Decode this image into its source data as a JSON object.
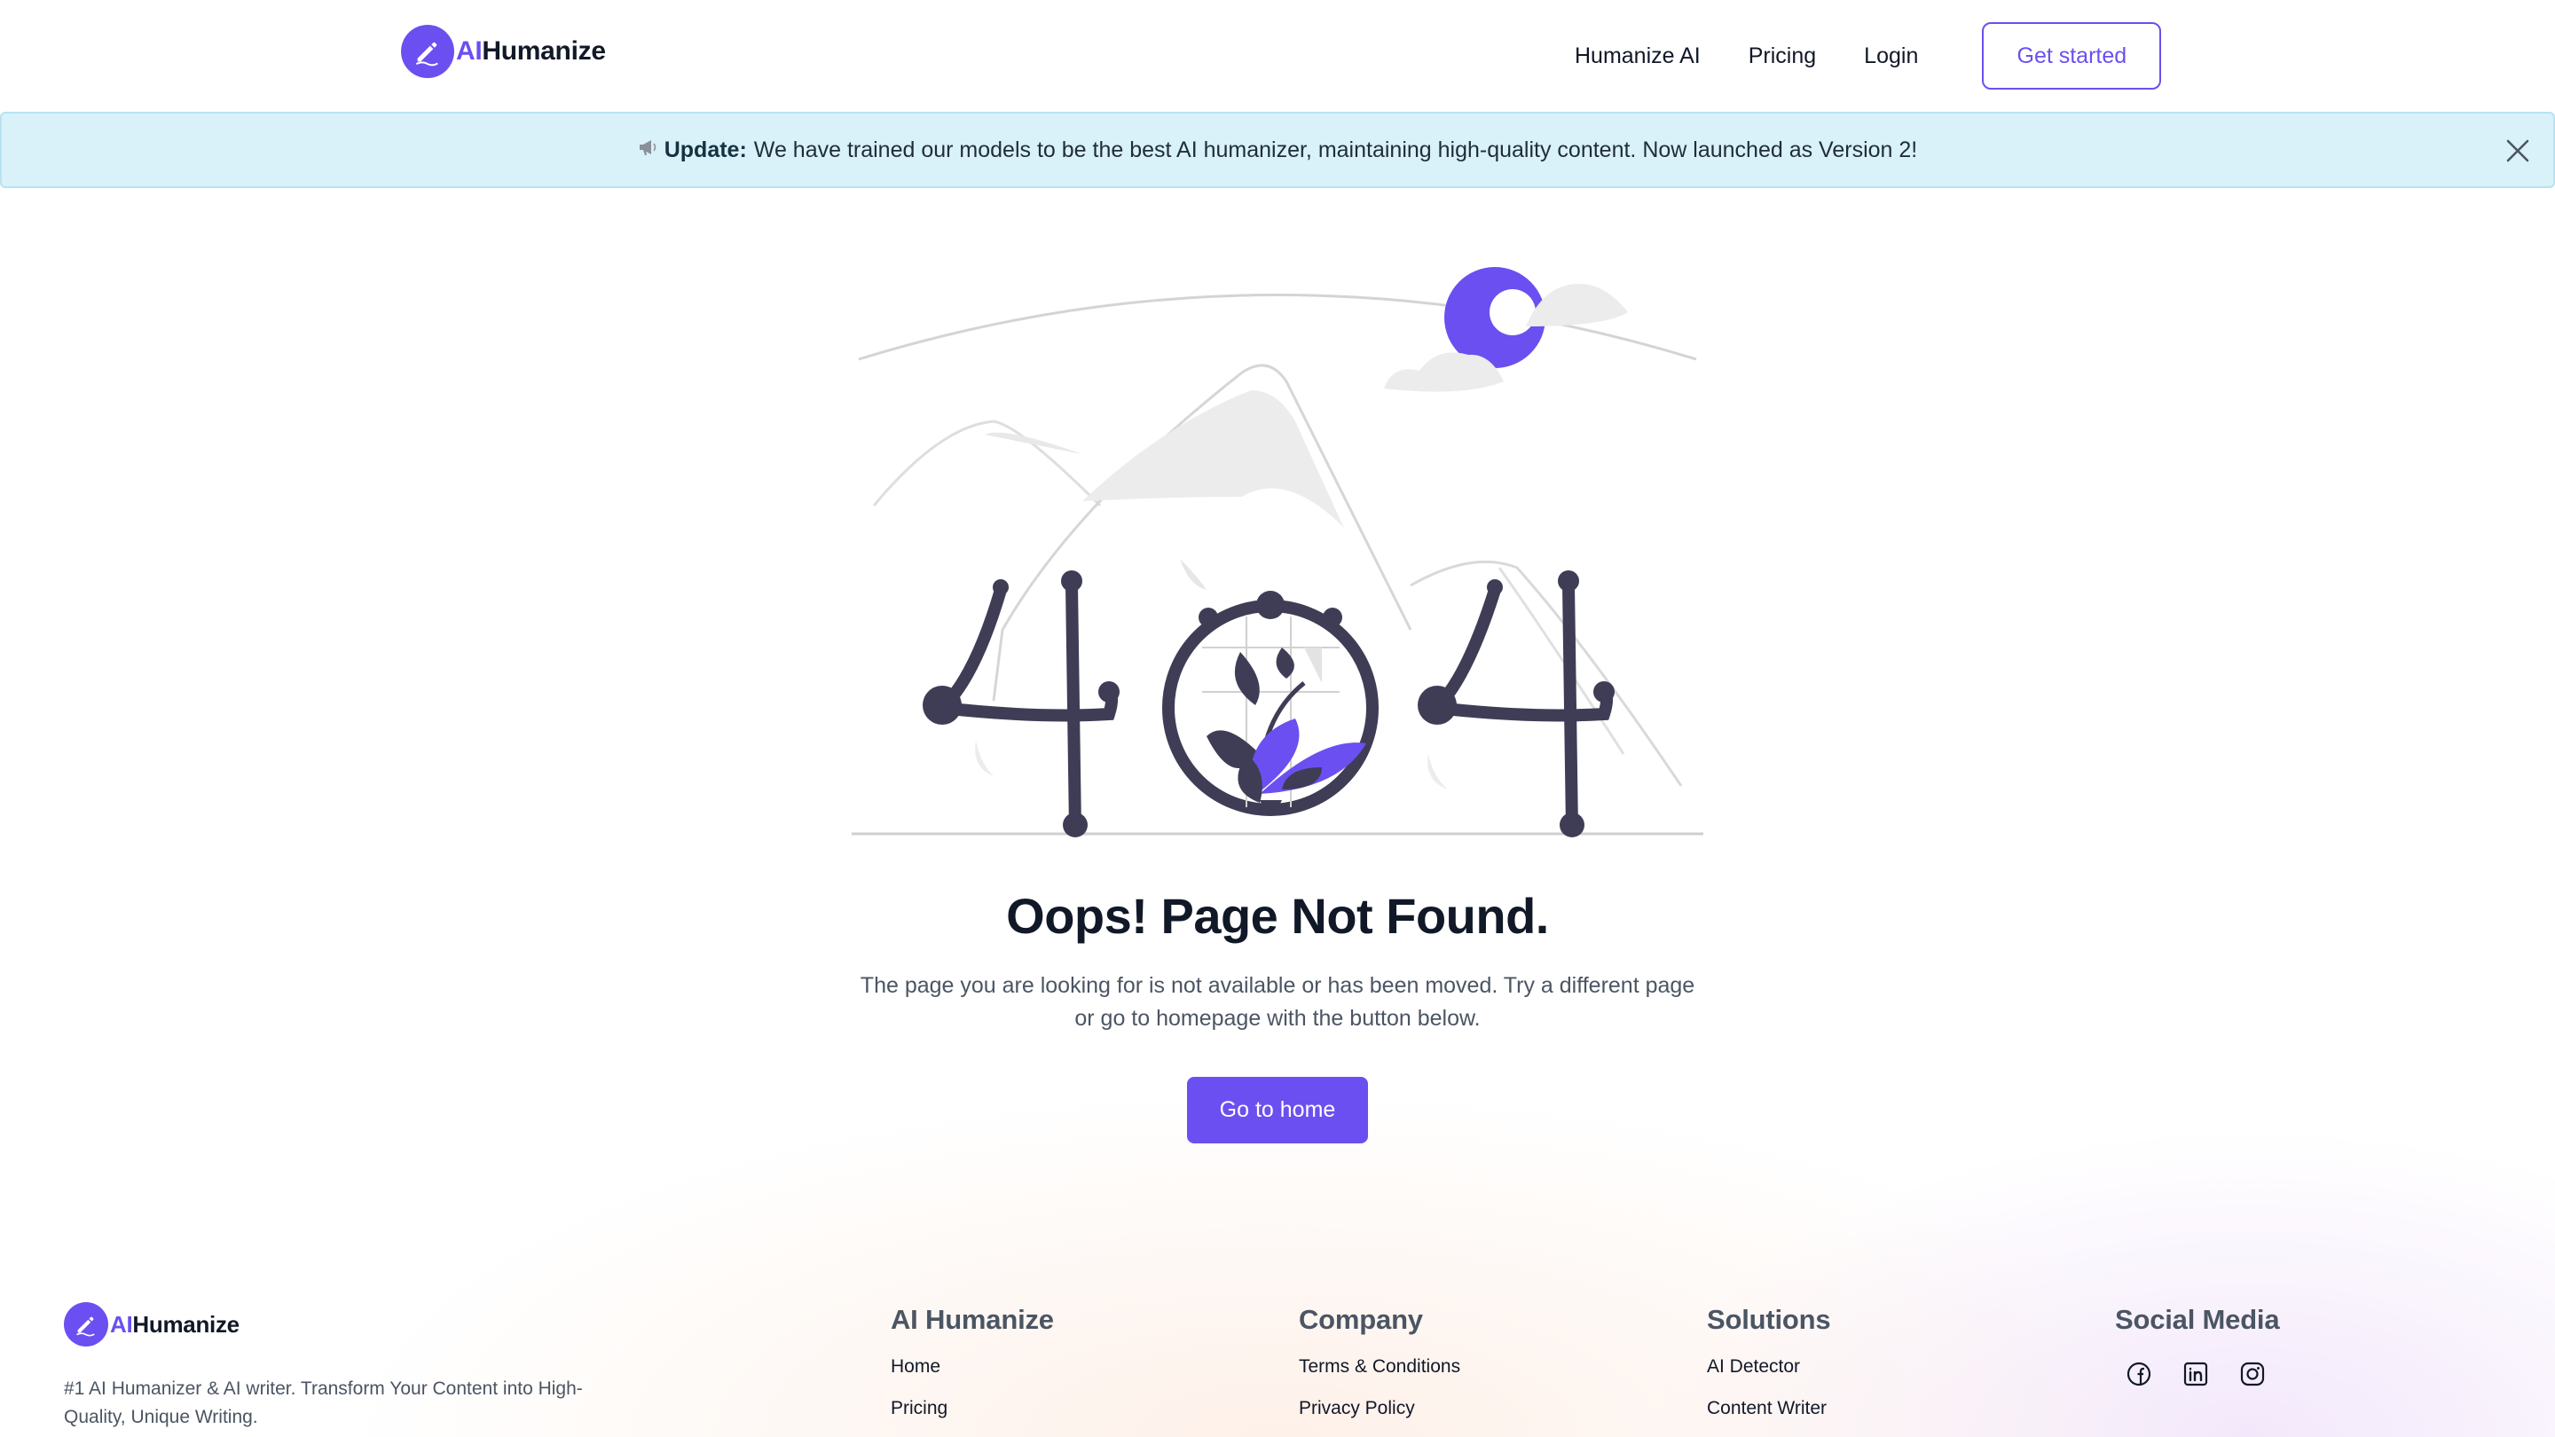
{
  "header": {
    "logo": {
      "ai": "AI",
      "rest": "Humanize"
    },
    "nav": [
      {
        "label": "Humanize AI"
      },
      {
        "label": "Pricing"
      },
      {
        "label": "Login"
      }
    ],
    "cta_label": "Get started"
  },
  "banner": {
    "icon": "megaphone-icon",
    "strong": "Update:",
    "text": "We have trained our models to be the best AI humanizer, maintaining high-quality content. Now launched as Version 2!"
  },
  "main": {
    "title": "Oops! Page Not Found.",
    "description": "The page you are looking for is not available or has been moved. Try a different page or go to homepage with the button below.",
    "button_label": "Go to home"
  },
  "footer": {
    "logo": {
      "ai": "AI",
      "rest": "Humanize"
    },
    "description": "#1 AI Humanizer & AI writer. Transform Your Content into High-Quality, Unique Writing.",
    "columns": [
      {
        "title": "AI Humanize",
        "links": [
          "Home",
          "Pricing"
        ]
      },
      {
        "title": "Company",
        "links": [
          "Terms & Conditions",
          "Privacy Policy"
        ]
      },
      {
        "title": "Solutions",
        "links": [
          "AI Detector",
          "Content Writer"
        ]
      }
    ],
    "social": {
      "title": "Social Media",
      "icons": [
        "facebook-icon",
        "linkedin-icon",
        "instagram-icon"
      ]
    }
  },
  "colors": {
    "accent": "#6c4ff0",
    "banner_bg": "#d9f1f9",
    "illustration_dark": "#3f3d56"
  }
}
